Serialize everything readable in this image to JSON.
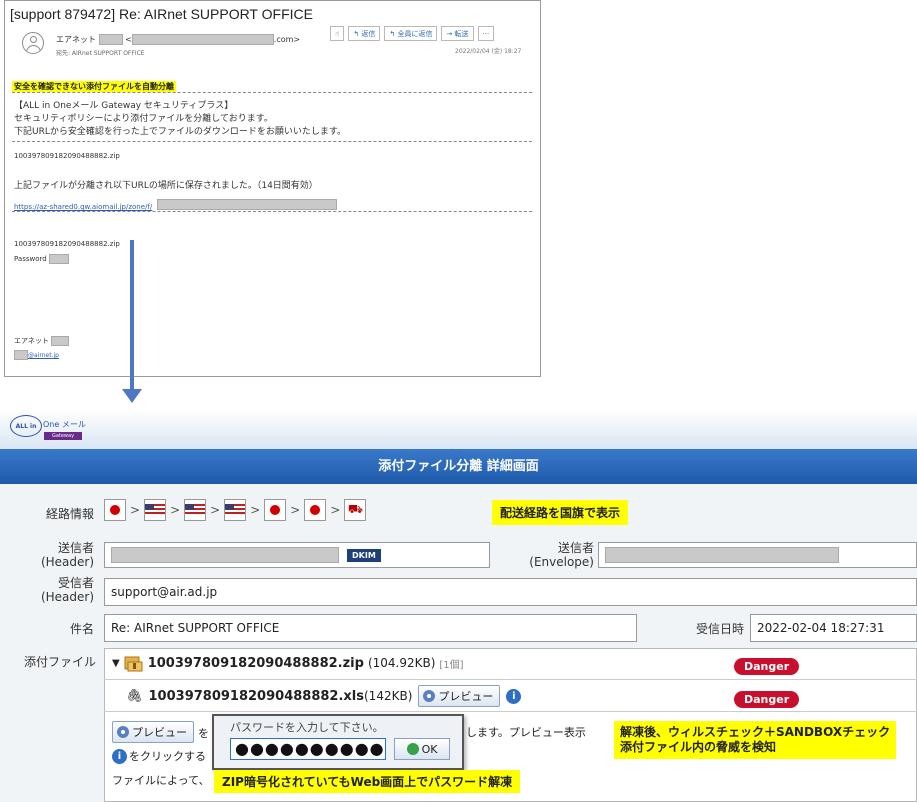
{
  "email": {
    "subject": "[support 879472] Re: AIRnet SUPPORT OFFICE",
    "from_name": "エアネット",
    "from_suffix": ".com>",
    "to_line": "宛先: AIRnet SUPPORT OFFICE",
    "toolbar": {
      "like": "",
      "reply": "返信",
      "reply_all": "全員に返信",
      "forward": "転送",
      "more": "···"
    },
    "date": "2022/02/04 (金) 18:27",
    "banner": "安全を確認できない添付ファイルを自動分離",
    "body_line1": "【ALL in Oneメール Gateway セキュリティプラス】",
    "body_line2": "セキュリティポリシーにより添付ファイルを分離しております。",
    "body_line3": "下記URLから安全確認を行った上でファイルのダウンロードをお願いいたします。",
    "file_name": "100397809182090488882.zip",
    "saved_notice": "上記ファイルが分離され以下URLの場所に保存されました。（14日間有効）",
    "url": "https://az-shared0.gw.aiomail.jp/zone/f/",
    "file_name2": "100397809182090488882.zip",
    "password_label": "Password",
    "signature_name": "エアネット",
    "signature_email": "@airnet.jp"
  },
  "app": {
    "logo_text": "One メール",
    "logo_circle": "ALL in",
    "logo_sub": "Gateway",
    "page_title": "添付ファイル分離 詳細画面",
    "route_label": "経路情報",
    "route_flags": [
      "jp",
      "us",
      "us",
      "us",
      "jp",
      "jp",
      "dest"
    ],
    "route_note": "配送経路を国旗で表示",
    "sender_header_label": "送信者\n(Header)",
    "dkim": "DKIM",
    "sender_envelope_label": "送信者\n(Envelope)",
    "recipient_label": "受信者\n(Header)",
    "recipient_value": "support@air.ad.jp",
    "subject_label": "件名",
    "subject_value": "Re: AIRnet SUPPORT OFFICE",
    "received_label": "受信日時",
    "received_value": "2022-02-04 18:27:31",
    "attachment_label": "添付ファイル",
    "zip_name": "100397809182090488882.zip",
    "zip_size": "(104.92KB)",
    "zip_count": "[1個]",
    "xls_name": "100397809182090488882.xls",
    "xls_size": "(142KB)",
    "preview_label": "プレビュー",
    "danger_label": "Danger",
    "note_row1_suffix": "します。プレビュー表示",
    "note_row2": "をクリックする",
    "note_row3": "ファイルによって、",
    "popup_prompt": "パスワードを入力して下さい。",
    "popup_password": "●●●●●●●●●●",
    "ok_label": "OK",
    "callout_sandbox_line1": "解凍後、ウィルスチェック＋SANDBOXチェック",
    "callout_sandbox_line2": "添付ファイル内の脅威を検知",
    "callout_zip": "ZIP暗号化されていてもWeb画面上でパスワード解凍"
  }
}
